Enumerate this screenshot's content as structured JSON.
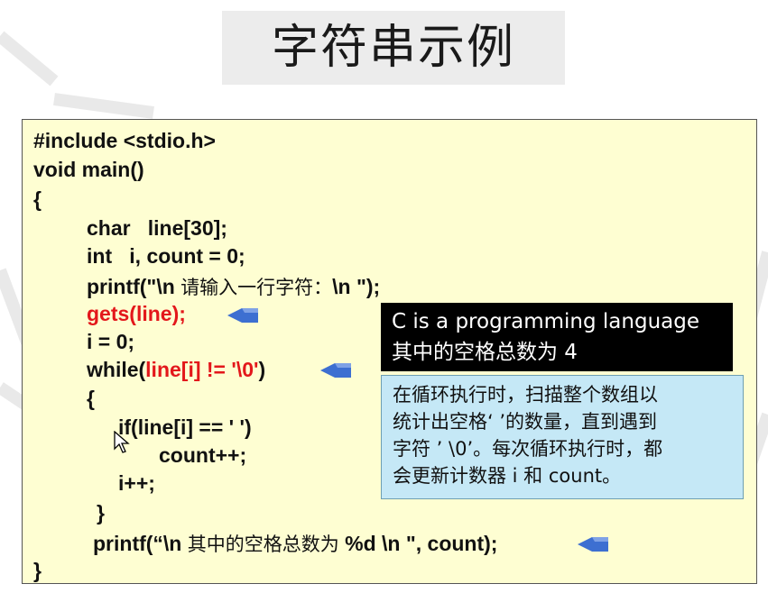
{
  "slide": {
    "title": "字符串示例"
  },
  "code": {
    "l1": "#include <stdio.h>",
    "l2": "void main()",
    "l3": "{",
    "l4": "char   line[30];",
    "l5": "int   i, count = 0;",
    "l6a": "printf(\"\\n ",
    "l6b": "请输入一行字符：",
    "l6c": "\\n \");",
    "l7": "gets(line);",
    "l8": "i = 0;",
    "l9a": "while(",
    "l9b": "line[i] != '\\0'",
    "l9c": ")",
    "l10": "{",
    "l11": "if(line[i] == ' ')",
    "l12": "count++;",
    "l13": "i++;",
    "l14": "}",
    "l15a": "printf(“\\n ",
    "l15b": "其中的空格总数为",
    "l15c": " %d \\n \", count);",
    "l16": "}"
  },
  "output": {
    "line1": "C is a programming language",
    "line2": "其中的空格总数为 4"
  },
  "note": {
    "line1": "在循环执行时，扫描整个数组以",
    "line2": "统计出空格‘ ’的数量，直到遇到",
    "line3": "字符 ’ \\0’。每次循环执行时，都",
    "line4": "会更新计数器 i 和 count。"
  },
  "colors": {
    "box_bg": "#fefed2",
    "highlight": "#e3171b",
    "arrow": "#3d6fd1",
    "note_bg": "#c5e8f6"
  },
  "icons": [
    "arrow-left-icon",
    "mouse-cursor-icon"
  ]
}
